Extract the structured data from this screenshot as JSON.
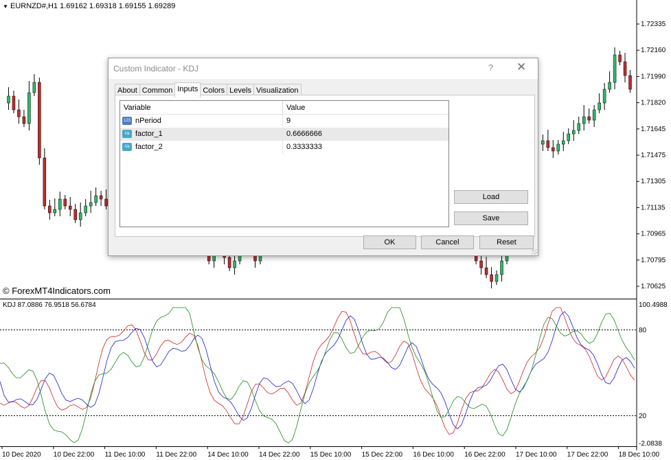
{
  "chart": {
    "header": "EURNZD#,H1  1.69162 1.69318 1.69155 1.69289",
    "watermark": "© ForexMT4Indicators.com",
    "price_axis": [
      "1.72335",
      "1.72160",
      "1.71990",
      "1.71820",
      "1.71645",
      "1.71475",
      "1.71305",
      "1.71135",
      "1.70965",
      "1.70795",
      "1.70625"
    ],
    "time_axis": [
      "10 Dec 2020",
      "10 Dec 22:00",
      "11 Dec 10:00",
      "11 Dec 22:00",
      "14 Dec 10:00",
      "14 Dec 22:00",
      "15 Dec 10:00",
      "15 Dec 22:00",
      "16 Dec 10:00",
      "16 Dec 22:00",
      "17 Dec 10:00",
      "17 Dec 22:00",
      "18 Dec 10:00"
    ],
    "colors": {
      "bull": "#2fb868",
      "bear": "#c42a2a",
      "k_line": "#cc2222",
      "d_line": "#1a1acc",
      "j_line": "#1a8a1a"
    }
  },
  "indicator": {
    "label": "KDJ 87.0886 76.9518 56.6784",
    "axis_top": "100.4988",
    "level_high": "80",
    "level_low": "20",
    "axis_bottom": "-2.0838"
  },
  "dialog": {
    "title": "Custom Indicator - KDJ",
    "help": "?",
    "close": "✕",
    "tabs": [
      "About",
      "Common",
      "Inputs",
      "Colors",
      "Levels",
      "Visualization"
    ],
    "active_tab": "Inputs",
    "columns": {
      "variable": "Variable",
      "value": "Value"
    },
    "rows": [
      {
        "icon": "123",
        "name": "nPeriod",
        "value": "9"
      },
      {
        "icon": "Va",
        "name": "factor_1",
        "value": "0.6666666"
      },
      {
        "icon": "Va",
        "name": "factor_2",
        "value": "0.3333333"
      }
    ],
    "buttons": {
      "load": "Load",
      "save": "Save",
      "ok": "OK",
      "cancel": "Cancel",
      "reset": "Reset"
    }
  }
}
